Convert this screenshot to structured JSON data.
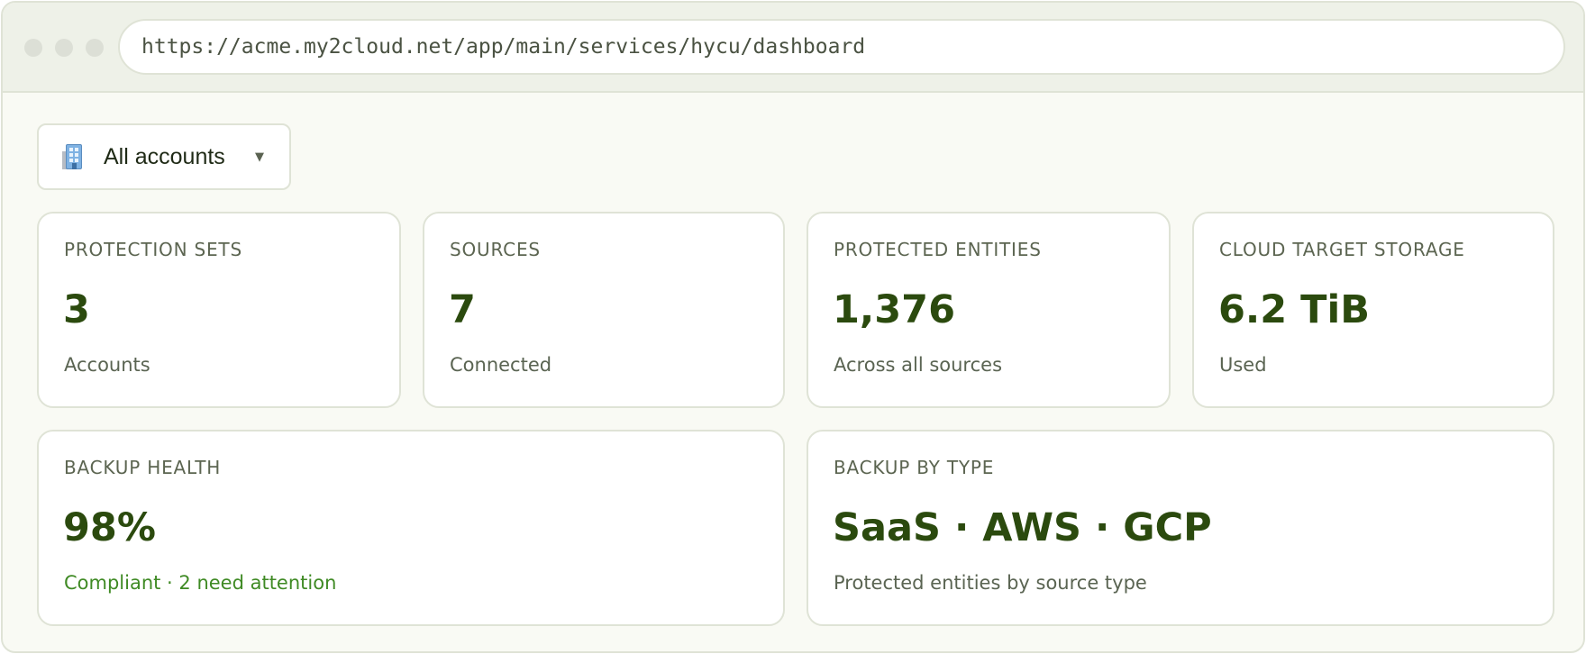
{
  "browser": {
    "url": "https://acme.my2cloud.net/app/main/services/hycu/dashboard"
  },
  "account_selector": {
    "icon": "building-icon",
    "label": "All accounts"
  },
  "cards": {
    "protection_sets": {
      "label": "PROTECTION SETS",
      "value": "3",
      "sub": "Accounts"
    },
    "sources": {
      "label": "SOURCES",
      "value": "7",
      "sub": "Connected"
    },
    "protected_entities": {
      "label": "PROTECTED ENTITIES",
      "value": "1,376",
      "sub": "Across all sources"
    },
    "cloud_target_storage": {
      "label": "CLOUD TARGET STORAGE",
      "value": "6.2 TiB",
      "sub": "Used"
    },
    "backup_health": {
      "label": "BACKUP HEALTH",
      "value": "98%",
      "sub": "Compliant · 2 need attention"
    },
    "backup_by_type": {
      "label": "BACKUP BY TYPE",
      "value": "SaaS · AWS · GCP",
      "sub": "Protected entities by source type"
    }
  },
  "colors": {
    "accent_value": "#2b4a0e",
    "status_ok": "#3f8a24",
    "background": "#f9faf4",
    "border": "#dfe3d6"
  }
}
